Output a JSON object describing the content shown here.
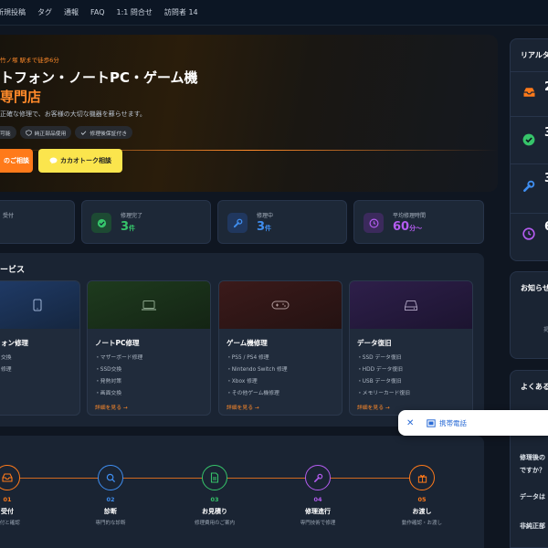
{
  "nav": {
    "items": [
      "新規投稿",
      "タグ",
      "通報",
      "FAQ",
      "1:1 問合せ",
      "訪問者 14"
    ]
  },
  "hero": {
    "eyebrow": "竹ノ塚 駅まで徒歩6分",
    "title_line1": "トフォン・ノートPC・ゲーム機",
    "title_line2": "専門店",
    "description": "正確な修理で、お客様の大切な機器を蘇らせます。",
    "tags": [
      "可能",
      "純正部品使用",
      "修理後保証付き"
    ],
    "button_primary": "のご相談",
    "button_kakao": "カカオトーク相談"
  },
  "stats": [
    {
      "label": "受付",
      "value": "",
      "unit": "",
      "color": "#ff8a2a"
    },
    {
      "label": "修理完了",
      "value": "3",
      "unit": "件",
      "color": "#36c46a"
    },
    {
      "label": "修理中",
      "value": "3",
      "unit": "件",
      "color": "#3f8ef0"
    },
    {
      "label": "平均修理時間",
      "value": "60",
      "unit": "分〜",
      "color": "#b45cf0"
    }
  ],
  "services": {
    "title": "ービス",
    "cards": [
      {
        "name": "ォン修理",
        "items": [
          "交換",
          "修理"
        ],
        "more": ""
      },
      {
        "name": "ノートPC修理",
        "items": [
          "・マザーボード修理",
          "・SSD交換",
          "・発熱対策",
          "・画面交換"
        ],
        "more": "詳細を見る →"
      },
      {
        "name": "ゲーム機修理",
        "items": [
          "・PS5 / PS4 修理",
          "・Nintendo Switch 修理",
          "・Xbox 修理",
          "・その他ゲーム機修理"
        ],
        "more": "詳細を見る →"
      },
      {
        "name": "データ復旧",
        "items": [
          "・SSD データ復旧",
          "・HDD データ復旧",
          "・USB データ復旧",
          "・メモリーカード復旧"
        ],
        "more": "詳細を見る →"
      }
    ]
  },
  "process": {
    "steps": [
      {
        "num": "01",
        "title": "受付",
        "desc": "受付と確認",
        "color": "#ff7a1a"
      },
      {
        "num": "02",
        "title": "診断",
        "desc": "専門的な診断",
        "color": "#3f8ef0"
      },
      {
        "num": "03",
        "title": "お見積り",
        "desc": "修理費用のご案内",
        "color": "#36c46a"
      },
      {
        "num": "04",
        "title": "修理進行",
        "desc": "専門技術で修理",
        "color": "#b45cf0"
      },
      {
        "num": "05",
        "title": "お渡し",
        "desc": "動作確認・お渡し",
        "color": "#ff7a1a"
      }
    ]
  },
  "sidebar": {
    "realtime_title": "リアルタ",
    "realtime_counts": [
      "2",
      "3",
      "3",
      "6"
    ],
    "notice_title": "お知らせ",
    "notice_text": "掲",
    "faq_title": "よくある",
    "faq_items": [
      "修理後の",
      "ですか？",
      "データは",
      "非純正部"
    ]
  },
  "popup": {
    "label": "携帯電話"
  }
}
